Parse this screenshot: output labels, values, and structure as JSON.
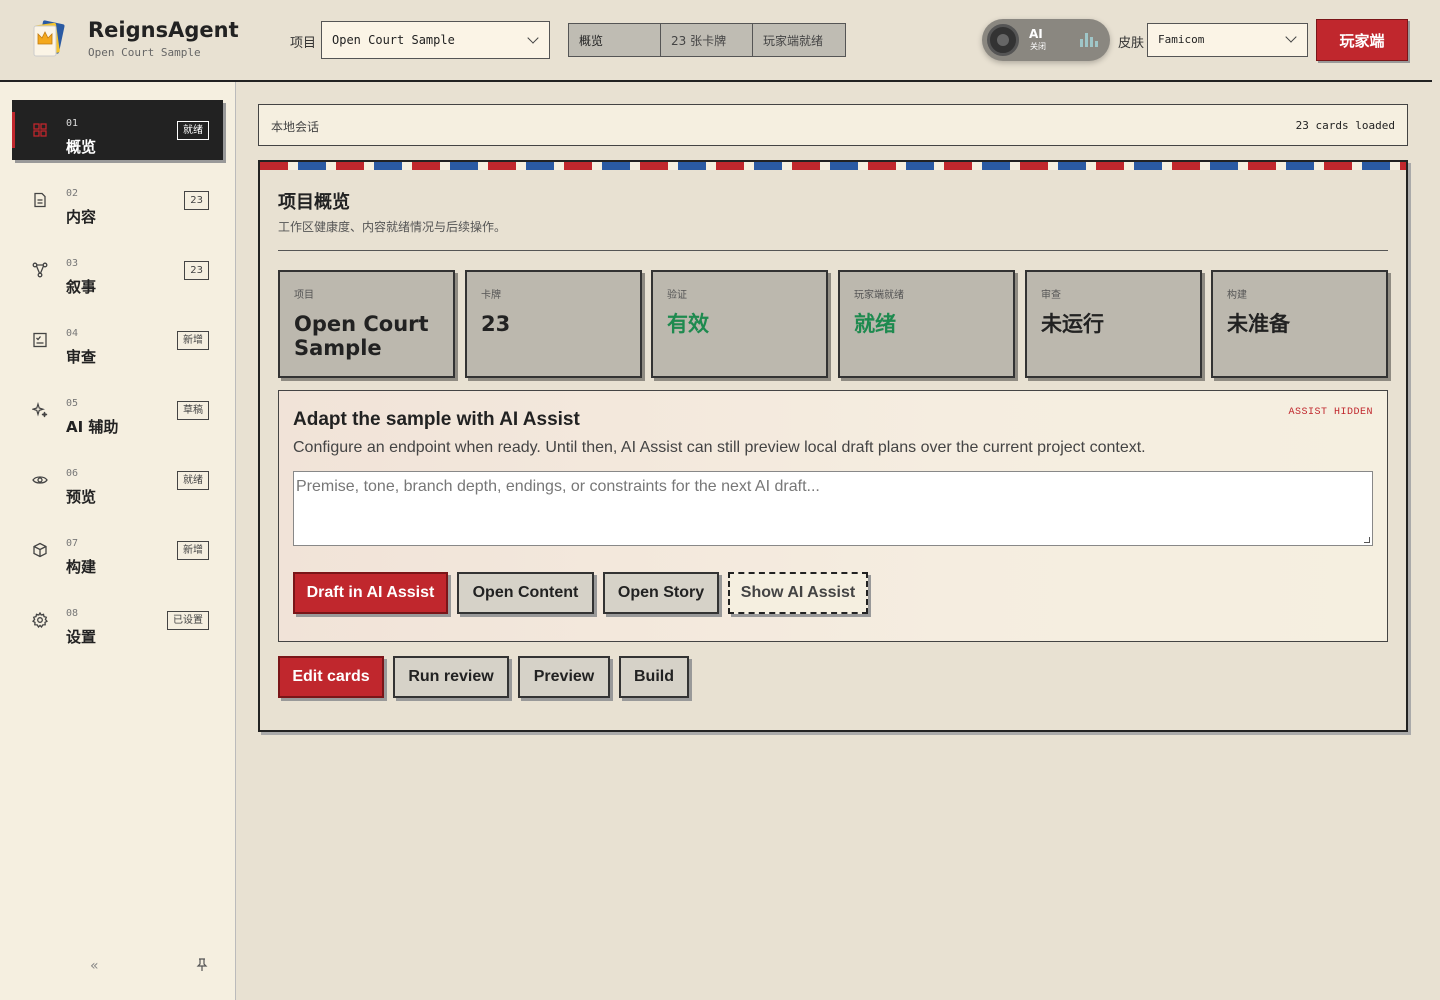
{
  "header": {
    "app_title": "ReignsAgent",
    "app_subtitle": "Open Court Sample",
    "project_label": "项目",
    "project_value": "Open Court Sample",
    "status": [
      "概览",
      "23 张卡牌",
      "玩家端就绪"
    ],
    "ai_toggle": {
      "label": "AI",
      "state": "关闭"
    },
    "skin_label": "皮肤",
    "skin_value": "Famicom",
    "player_button": "玩家端"
  },
  "sidebar": {
    "items": [
      {
        "num": "01",
        "label": "概览",
        "badge": "就绪",
        "icon": "grid-icon",
        "active": true
      },
      {
        "num": "02",
        "label": "内容",
        "badge": "23",
        "icon": "document-icon"
      },
      {
        "num": "03",
        "label": "叙事",
        "badge": "23",
        "icon": "branch-icon"
      },
      {
        "num": "04",
        "label": "审查",
        "badge": "新增",
        "icon": "checklist-icon"
      },
      {
        "num": "05",
        "label": "AI 辅助",
        "badge": "草稿",
        "icon": "sparkle-icon"
      },
      {
        "num": "06",
        "label": "预览",
        "badge": "就绪",
        "icon": "eye-icon"
      },
      {
        "num": "07",
        "label": "构建",
        "badge": "新增",
        "icon": "cube-icon"
      },
      {
        "num": "08",
        "label": "设置",
        "badge": "已设置",
        "icon": "gear-icon"
      }
    ],
    "collapse_icon": "double-chevron-left-icon",
    "pin_icon": "pin-icon"
  },
  "session": {
    "label": "本地会话",
    "count": "23 cards loaded"
  },
  "overview": {
    "title": "项目概览",
    "subtitle": "工作区健康度、内容就绪情况与后续操作。",
    "stats": [
      {
        "key": "项目",
        "value": "Open Court Sample"
      },
      {
        "key": "卡牌",
        "value": "23"
      },
      {
        "key": "验证",
        "value": "有效",
        "tone": "good"
      },
      {
        "key": "玩家端就绪",
        "value": "就绪",
        "tone": "good"
      },
      {
        "key": "审查",
        "value": "未运行"
      },
      {
        "key": "构建",
        "value": "未准备"
      }
    ]
  },
  "assist": {
    "title": "Adapt the sample with AI Assist",
    "badge": "ASSIST HIDDEN",
    "description": "Configure an endpoint when ready. Until then, AI Assist can still preview local draft plans over the current project context.",
    "placeholder": "Premise, tone, branch depth, endings, or constraints for the next AI draft...",
    "buttons": {
      "draft": "Draft in AI Assist",
      "open_content": "Open Content",
      "open_story": "Open Story",
      "show_assist": "Show AI Assist"
    }
  },
  "actions": {
    "edit_cards": "Edit cards",
    "run_review": "Run review",
    "preview": "Preview",
    "build": "Build"
  },
  "colors": {
    "accent": "#c0272d",
    "good": "#1e8a4f",
    "background": "#e8e1d2",
    "stripe_blue": "#2a5aa3"
  }
}
